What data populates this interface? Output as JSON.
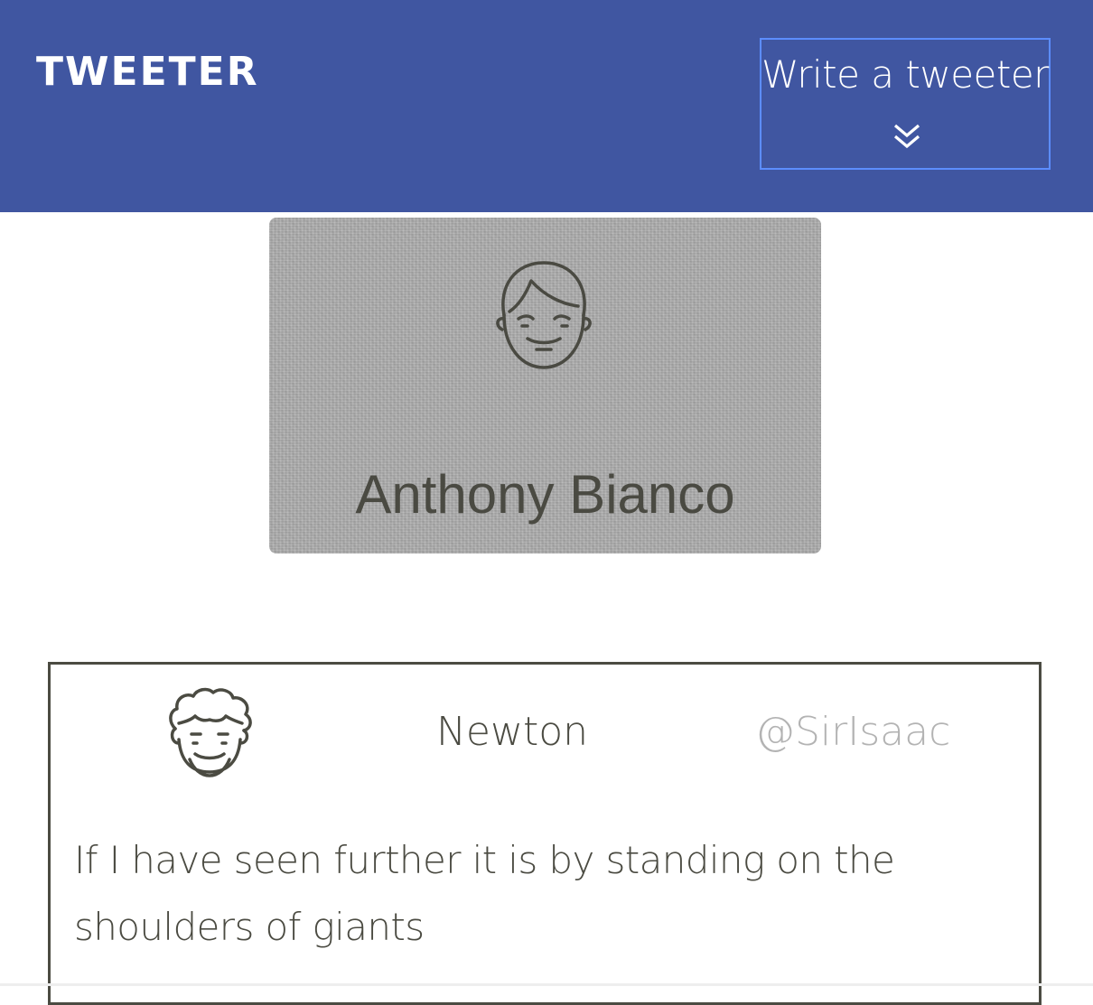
{
  "header": {
    "logo": "TWEETER",
    "write_button_label": "Write a tweeter",
    "write_button_icon": "double-chevron-down-icon",
    "background_color": "#4056a1",
    "button_border_color": "#5c8dff"
  },
  "profile": {
    "name": "Anthony Bianco",
    "avatar_icon": "face-avatar-icon"
  },
  "tweets": [
    {
      "name": "Newton",
      "handle": "@SirIsaac",
      "text": "If I have seen further it is by standing on the shoulders of giants",
      "avatar_icon": "curly-hair-avatar-icon"
    }
  ]
}
